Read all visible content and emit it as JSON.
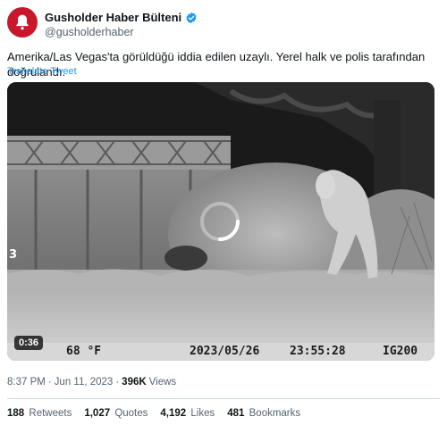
{
  "author": {
    "display_name": "Gusholder Haber Bülteni",
    "handle": "@gusholderhaber",
    "avatar_icon": "bell-icon",
    "avatar_color": "#c8182b",
    "verified_color": "#1d9bf0"
  },
  "tweet": {
    "text": "Amerika/Las Vegas'ta görüldüğü iddia edilen uzaylı. Yerel halk ve polis tarafından doğrulandı.",
    "translate_label": "Translate Tweet"
  },
  "video": {
    "duration": "0:36",
    "overlay_number": "3",
    "camera_temp": "68 °F",
    "camera_date": "2023/05/26",
    "camera_time": "23:55:28",
    "camera_code": "IG200"
  },
  "meta": {
    "time": "8:37 PM",
    "separator1": "·",
    "date": "Jun 11, 2023",
    "separator2": "·",
    "views_count": "396K",
    "views_label": "Views"
  },
  "stats": {
    "retweets_count": "188",
    "retweets_label": "Retweets",
    "quotes_count": "1,027",
    "quotes_label": "Quotes",
    "likes_count": "4,192",
    "likes_label": "Likes",
    "bookmarks_count": "481",
    "bookmarks_label": "Bookmarks"
  }
}
